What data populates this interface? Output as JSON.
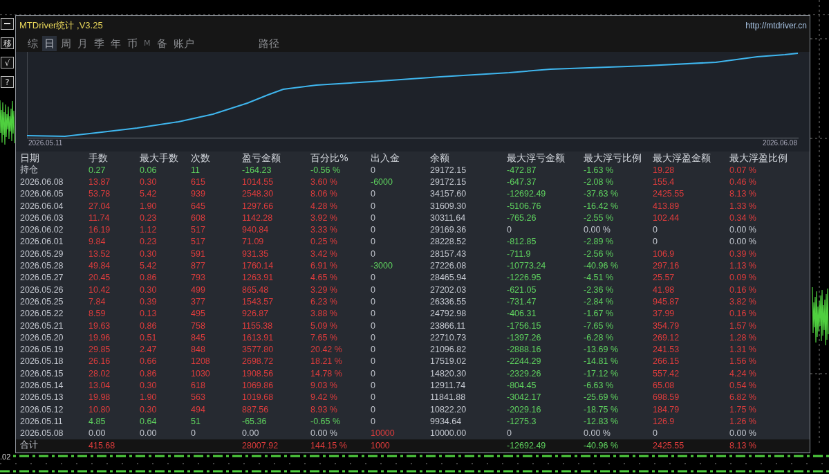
{
  "window": {
    "title": "MTDriver统计 ,V3.25",
    "link": "http://mtdriver.cn"
  },
  "side_buttons": [
    {
      "kind": "minimize"
    },
    {
      "kind": "text",
      "text": "移"
    },
    {
      "kind": "text",
      "text": "√"
    },
    {
      "kind": "text",
      "text": "?"
    }
  ],
  "tabs": [
    {
      "label": "综",
      "selected": false,
      "dim": false
    },
    {
      "label": "日",
      "selected": true,
      "dim": false
    },
    {
      "label": "周",
      "selected": false,
      "dim": false
    },
    {
      "label": "月",
      "selected": false,
      "dim": false
    },
    {
      "label": "季",
      "selected": false,
      "dim": false
    },
    {
      "label": "年",
      "selected": false,
      "dim": false
    },
    {
      "label": "币",
      "selected": false,
      "dim": false
    },
    {
      "label": "M",
      "selected": false,
      "dim": true
    },
    {
      "label": "备",
      "selected": false,
      "dim": false
    },
    {
      "label": "账户",
      "selected": false,
      "dim": false
    }
  ],
  "path_tab": {
    "label": "路径",
    "selected": false
  },
  "equity_chart": {
    "start_label": "2026.05.11",
    "end_label": "2026.06.08"
  },
  "table": {
    "columns": [
      "日期",
      "手数",
      "最大手数",
      "次数",
      "盈亏金额",
      "百分比%",
      "出入金",
      "余额",
      "最大浮亏金额",
      "最大浮亏比例",
      "最大浮盈金额",
      "最大浮盈比例"
    ],
    "rows": [
      {
        "date": "持仓",
        "lots": {
          "text": "0.27",
          "color": "#5fd35f"
        },
        "max_lots": {
          "text": "0.06",
          "color": "#5fd35f"
        },
        "trades": {
          "text": "11",
          "color": "#5fd35f"
        },
        "profit": {
          "text": "-164.23",
          "color": "#5fd35f"
        },
        "percent": {
          "text": "-0.56 %",
          "color": "#5fd35f"
        },
        "deposit": {
          "text": "0",
          "color": "#c4c8d0"
        },
        "balance": {
          "text": "29172.15",
          "color": "#c4c8d0"
        },
        "max_float_loss": {
          "text": "-472.87",
          "color": "#5fd35f"
        },
        "max_float_loss_pct": {
          "text": "-1.63 %",
          "color": "#5fd35f"
        },
        "max_float_profit": {
          "text": "19.28",
          "color": "#e03c3c"
        },
        "max_float_profit_pct": {
          "text": "0.07 %",
          "color": "#e03c3c"
        }
      },
      {
        "date": "2026.06.08",
        "lots": {
          "text": "13.87",
          "color": "#e03c3c"
        },
        "max_lots": {
          "text": "0.30",
          "color": "#e03c3c"
        },
        "trades": {
          "text": "615",
          "color": "#e03c3c"
        },
        "profit": {
          "text": "1014.55",
          "color": "#e03c3c"
        },
        "percent": {
          "text": "3.60 %",
          "color": "#e03c3c"
        },
        "deposit": {
          "text": "-6000",
          "color": "#5fd35f"
        },
        "balance": {
          "text": "29172.15",
          "color": "#c4c8d0"
        },
        "max_float_loss": {
          "text": "-647.37",
          "color": "#5fd35f"
        },
        "max_float_loss_pct": {
          "text": "-2.08 %",
          "color": "#5fd35f"
        },
        "max_float_profit": {
          "text": "155.4",
          "color": "#e03c3c"
        },
        "max_float_profit_pct": {
          "text": "0.46 %",
          "color": "#e03c3c"
        }
      },
      {
        "date": "2026.06.05",
        "lots": {
          "text": "53.78",
          "color": "#e03c3c"
        },
        "max_lots": {
          "text": "5.42",
          "color": "#e03c3c"
        },
        "trades": {
          "text": "939",
          "color": "#e03c3c"
        },
        "profit": {
          "text": "2548.30",
          "color": "#e03c3c"
        },
        "percent": {
          "text": "8.06 %",
          "color": "#e03c3c"
        },
        "deposit": {
          "text": "0",
          "color": "#c4c8d0"
        },
        "balance": {
          "text": "34157.60",
          "color": "#c4c8d0"
        },
        "max_float_loss": {
          "text": "-12692.49",
          "color": "#5fd35f"
        },
        "max_float_loss_pct": {
          "text": "-37.63 %",
          "color": "#5fd35f"
        },
        "max_float_profit": {
          "text": "2425.55",
          "color": "#e03c3c"
        },
        "max_float_profit_pct": {
          "text": "8.13 %",
          "color": "#e03c3c"
        }
      },
      {
        "date": "2026.06.04",
        "lots": {
          "text": "27.04",
          "color": "#e03c3c"
        },
        "max_lots": {
          "text": "1.90",
          "color": "#e03c3c"
        },
        "trades": {
          "text": "645",
          "color": "#e03c3c"
        },
        "profit": {
          "text": "1297.66",
          "color": "#e03c3c"
        },
        "percent": {
          "text": "4.28 %",
          "color": "#e03c3c"
        },
        "deposit": {
          "text": "0",
          "color": "#c4c8d0"
        },
        "balance": {
          "text": "31609.30",
          "color": "#c4c8d0"
        },
        "max_float_loss": {
          "text": "-5106.76",
          "color": "#5fd35f"
        },
        "max_float_loss_pct": {
          "text": "-16.42 %",
          "color": "#5fd35f"
        },
        "max_float_profit": {
          "text": "413.89",
          "color": "#e03c3c"
        },
        "max_float_profit_pct": {
          "text": "1.33 %",
          "color": "#e03c3c"
        }
      },
      {
        "date": "2026.06.03",
        "lots": {
          "text": "11.74",
          "color": "#e03c3c"
        },
        "max_lots": {
          "text": "0.23",
          "color": "#e03c3c"
        },
        "trades": {
          "text": "608",
          "color": "#e03c3c"
        },
        "profit": {
          "text": "1142.28",
          "color": "#e03c3c"
        },
        "percent": {
          "text": "3.92 %",
          "color": "#e03c3c"
        },
        "deposit": {
          "text": "0",
          "color": "#c4c8d0"
        },
        "balance": {
          "text": "30311.64",
          "color": "#c4c8d0"
        },
        "max_float_loss": {
          "text": "-765.26",
          "color": "#5fd35f"
        },
        "max_float_loss_pct": {
          "text": "-2.55 %",
          "color": "#5fd35f"
        },
        "max_float_profit": {
          "text": "102.44",
          "color": "#e03c3c"
        },
        "max_float_profit_pct": {
          "text": "0.34 %",
          "color": "#e03c3c"
        }
      },
      {
        "date": "2026.06.02",
        "lots": {
          "text": "16.19",
          "color": "#e03c3c"
        },
        "max_lots": {
          "text": "1.12",
          "color": "#e03c3c"
        },
        "trades": {
          "text": "517",
          "color": "#e03c3c"
        },
        "profit": {
          "text": "940.84",
          "color": "#e03c3c"
        },
        "percent": {
          "text": "3.33 %",
          "color": "#e03c3c"
        },
        "deposit": {
          "text": "0",
          "color": "#c4c8d0"
        },
        "balance": {
          "text": "29169.36",
          "color": "#c4c8d0"
        },
        "max_float_loss": {
          "text": "0",
          "color": "#c4c8d0"
        },
        "max_float_loss_pct": {
          "text": "0.00 %",
          "color": "#c4c8d0"
        },
        "max_float_profit": {
          "text": "0",
          "color": "#c4c8d0"
        },
        "max_float_profit_pct": {
          "text": "0.00 %",
          "color": "#c4c8d0"
        }
      },
      {
        "date": "2026.06.01",
        "lots": {
          "text": "9.84",
          "color": "#e03c3c"
        },
        "max_lots": {
          "text": "0.23",
          "color": "#e03c3c"
        },
        "trades": {
          "text": "517",
          "color": "#e03c3c"
        },
        "profit": {
          "text": "71.09",
          "color": "#e03c3c"
        },
        "percent": {
          "text": "0.25 %",
          "color": "#e03c3c"
        },
        "deposit": {
          "text": "0",
          "color": "#c4c8d0"
        },
        "balance": {
          "text": "28228.52",
          "color": "#c4c8d0"
        },
        "max_float_loss": {
          "text": "-812.85",
          "color": "#5fd35f"
        },
        "max_float_loss_pct": {
          "text": "-2.89 %",
          "color": "#5fd35f"
        },
        "max_float_profit": {
          "text": "0",
          "color": "#c4c8d0"
        },
        "max_float_profit_pct": {
          "text": "0.00 %",
          "color": "#c4c8d0"
        }
      },
      {
        "date": "2026.05.29",
        "lots": {
          "text": "13.52",
          "color": "#e03c3c"
        },
        "max_lots": {
          "text": "0.30",
          "color": "#e03c3c"
        },
        "trades": {
          "text": "591",
          "color": "#e03c3c"
        },
        "profit": {
          "text": "931.35",
          "color": "#e03c3c"
        },
        "percent": {
          "text": "3.42 %",
          "color": "#e03c3c"
        },
        "deposit": {
          "text": "0",
          "color": "#c4c8d0"
        },
        "balance": {
          "text": "28157.43",
          "color": "#c4c8d0"
        },
        "max_float_loss": {
          "text": "-711.9",
          "color": "#5fd35f"
        },
        "max_float_loss_pct": {
          "text": "-2.56 %",
          "color": "#5fd35f"
        },
        "max_float_profit": {
          "text": "106.9",
          "color": "#e03c3c"
        },
        "max_float_profit_pct": {
          "text": "0.39 %",
          "color": "#e03c3c"
        }
      },
      {
        "date": "2026.05.28",
        "lots": {
          "text": "49.84",
          "color": "#e03c3c"
        },
        "max_lots": {
          "text": "5.42",
          "color": "#e03c3c"
        },
        "trades": {
          "text": "877",
          "color": "#e03c3c"
        },
        "profit": {
          "text": "1760.14",
          "color": "#e03c3c"
        },
        "percent": {
          "text": "6.91 %",
          "color": "#e03c3c"
        },
        "deposit": {
          "text": "-3000",
          "color": "#5fd35f"
        },
        "balance": {
          "text": "27226.08",
          "color": "#c4c8d0"
        },
        "max_float_loss": {
          "text": "-10773.24",
          "color": "#5fd35f"
        },
        "max_float_loss_pct": {
          "text": "-40.96 %",
          "color": "#5fd35f"
        },
        "max_float_profit": {
          "text": "297.16",
          "color": "#e03c3c"
        },
        "max_float_profit_pct": {
          "text": "1.13 %",
          "color": "#e03c3c"
        }
      },
      {
        "date": "2026.05.27",
        "lots": {
          "text": "20.45",
          "color": "#e03c3c"
        },
        "max_lots": {
          "text": "0.86",
          "color": "#e03c3c"
        },
        "trades": {
          "text": "793",
          "color": "#e03c3c"
        },
        "profit": {
          "text": "1263.91",
          "color": "#e03c3c"
        },
        "percent": {
          "text": "4.65 %",
          "color": "#e03c3c"
        },
        "deposit": {
          "text": "0",
          "color": "#c4c8d0"
        },
        "balance": {
          "text": "28465.94",
          "color": "#c4c8d0"
        },
        "max_float_loss": {
          "text": "-1226.95",
          "color": "#5fd35f"
        },
        "max_float_loss_pct": {
          "text": "-4.51 %",
          "color": "#5fd35f"
        },
        "max_float_profit": {
          "text": "25.57",
          "color": "#e03c3c"
        },
        "max_float_profit_pct": {
          "text": "0.09 %",
          "color": "#e03c3c"
        }
      },
      {
        "date": "2026.05.26",
        "lots": {
          "text": "10.42",
          "color": "#e03c3c"
        },
        "max_lots": {
          "text": "0.30",
          "color": "#e03c3c"
        },
        "trades": {
          "text": "499",
          "color": "#e03c3c"
        },
        "profit": {
          "text": "865.48",
          "color": "#e03c3c"
        },
        "percent": {
          "text": "3.29 %",
          "color": "#e03c3c"
        },
        "deposit": {
          "text": "0",
          "color": "#c4c8d0"
        },
        "balance": {
          "text": "27202.03",
          "color": "#c4c8d0"
        },
        "max_float_loss": {
          "text": "-621.05",
          "color": "#5fd35f"
        },
        "max_float_loss_pct": {
          "text": "-2.36 %",
          "color": "#5fd35f"
        },
        "max_float_profit": {
          "text": "41.98",
          "color": "#e03c3c"
        },
        "max_float_profit_pct": {
          "text": "0.16 %",
          "color": "#e03c3c"
        }
      },
      {
        "date": "2026.05.25",
        "lots": {
          "text": "7.84",
          "color": "#e03c3c"
        },
        "max_lots": {
          "text": "0.39",
          "color": "#e03c3c"
        },
        "trades": {
          "text": "377",
          "color": "#e03c3c"
        },
        "profit": {
          "text": "1543.57",
          "color": "#e03c3c"
        },
        "percent": {
          "text": "6.23 %",
          "color": "#e03c3c"
        },
        "deposit": {
          "text": "0",
          "color": "#c4c8d0"
        },
        "balance": {
          "text": "26336.55",
          "color": "#c4c8d0"
        },
        "max_float_loss": {
          "text": "-731.47",
          "color": "#5fd35f"
        },
        "max_float_loss_pct": {
          "text": "-2.84 %",
          "color": "#5fd35f"
        },
        "max_float_profit": {
          "text": "945.87",
          "color": "#e03c3c"
        },
        "max_float_profit_pct": {
          "text": "3.82 %",
          "color": "#e03c3c"
        }
      },
      {
        "date": "2026.05.22",
        "lots": {
          "text": "8.59",
          "color": "#e03c3c"
        },
        "max_lots": {
          "text": "0.13",
          "color": "#e03c3c"
        },
        "trades": {
          "text": "495",
          "color": "#e03c3c"
        },
        "profit": {
          "text": "926.87",
          "color": "#e03c3c"
        },
        "percent": {
          "text": "3.88 %",
          "color": "#e03c3c"
        },
        "deposit": {
          "text": "0",
          "color": "#c4c8d0"
        },
        "balance": {
          "text": "24792.98",
          "color": "#c4c8d0"
        },
        "max_float_loss": {
          "text": "-406.31",
          "color": "#5fd35f"
        },
        "max_float_loss_pct": {
          "text": "-1.67 %",
          "color": "#5fd35f"
        },
        "max_float_profit": {
          "text": "37.99",
          "color": "#e03c3c"
        },
        "max_float_profit_pct": {
          "text": "0.16 %",
          "color": "#e03c3c"
        }
      },
      {
        "date": "2026.05.21",
        "lots": {
          "text": "19.63",
          "color": "#e03c3c"
        },
        "max_lots": {
          "text": "0.86",
          "color": "#e03c3c"
        },
        "trades": {
          "text": "758",
          "color": "#e03c3c"
        },
        "profit": {
          "text": "1155.38",
          "color": "#e03c3c"
        },
        "percent": {
          "text": "5.09 %",
          "color": "#e03c3c"
        },
        "deposit": {
          "text": "0",
          "color": "#c4c8d0"
        },
        "balance": {
          "text": "23866.11",
          "color": "#c4c8d0"
        },
        "max_float_loss": {
          "text": "-1756.15",
          "color": "#5fd35f"
        },
        "max_float_loss_pct": {
          "text": "-7.65 %",
          "color": "#5fd35f"
        },
        "max_float_profit": {
          "text": "354.79",
          "color": "#e03c3c"
        },
        "max_float_profit_pct": {
          "text": "1.57 %",
          "color": "#e03c3c"
        }
      },
      {
        "date": "2026.05.20",
        "lots": {
          "text": "19.96",
          "color": "#e03c3c"
        },
        "max_lots": {
          "text": "0.51",
          "color": "#e03c3c"
        },
        "trades": {
          "text": "845",
          "color": "#e03c3c"
        },
        "profit": {
          "text": "1613.91",
          "color": "#e03c3c"
        },
        "percent": {
          "text": "7.65 %",
          "color": "#e03c3c"
        },
        "deposit": {
          "text": "0",
          "color": "#c4c8d0"
        },
        "balance": {
          "text": "22710.73",
          "color": "#c4c8d0"
        },
        "max_float_loss": {
          "text": "-1397.26",
          "color": "#5fd35f"
        },
        "max_float_loss_pct": {
          "text": "-6.28 %",
          "color": "#5fd35f"
        },
        "max_float_profit": {
          "text": "269.12",
          "color": "#e03c3c"
        },
        "max_float_profit_pct": {
          "text": "1.28 %",
          "color": "#e03c3c"
        }
      },
      {
        "date": "2026.05.19",
        "lots": {
          "text": "29.85",
          "color": "#e03c3c"
        },
        "max_lots": {
          "text": "2.47",
          "color": "#e03c3c"
        },
        "trades": {
          "text": "848",
          "color": "#e03c3c"
        },
        "profit": {
          "text": "3577.80",
          "color": "#e03c3c"
        },
        "percent": {
          "text": "20.42 %",
          "color": "#e03c3c"
        },
        "deposit": {
          "text": "0",
          "color": "#c4c8d0"
        },
        "balance": {
          "text": "21096.82",
          "color": "#c4c8d0"
        },
        "max_float_loss": {
          "text": "-2888.16",
          "color": "#5fd35f"
        },
        "max_float_loss_pct": {
          "text": "-13.69 %",
          "color": "#5fd35f"
        },
        "max_float_profit": {
          "text": "241.53",
          "color": "#e03c3c"
        },
        "max_float_profit_pct": {
          "text": "1.31 %",
          "color": "#e03c3c"
        }
      },
      {
        "date": "2026.05.18",
        "lots": {
          "text": "26.16",
          "color": "#e03c3c"
        },
        "max_lots": {
          "text": "0.66",
          "color": "#e03c3c"
        },
        "trades": {
          "text": "1208",
          "color": "#e03c3c"
        },
        "profit": {
          "text": "2698.72",
          "color": "#e03c3c"
        },
        "percent": {
          "text": "18.21 %",
          "color": "#e03c3c"
        },
        "deposit": {
          "text": "0",
          "color": "#c4c8d0"
        },
        "balance": {
          "text": "17519.02",
          "color": "#c4c8d0"
        },
        "max_float_loss": {
          "text": "-2244.29",
          "color": "#5fd35f"
        },
        "max_float_loss_pct": {
          "text": "-14.81 %",
          "color": "#5fd35f"
        },
        "max_float_profit": {
          "text": "266.15",
          "color": "#e03c3c"
        },
        "max_float_profit_pct": {
          "text": "1.56 %",
          "color": "#e03c3c"
        }
      },
      {
        "date": "2026.05.15",
        "lots": {
          "text": "28.02",
          "color": "#e03c3c"
        },
        "max_lots": {
          "text": "0.86",
          "color": "#e03c3c"
        },
        "trades": {
          "text": "1030",
          "color": "#e03c3c"
        },
        "profit": {
          "text": "1908.56",
          "color": "#e03c3c"
        },
        "percent": {
          "text": "14.78 %",
          "color": "#e03c3c"
        },
        "deposit": {
          "text": "0",
          "color": "#c4c8d0"
        },
        "balance": {
          "text": "14820.30",
          "color": "#c4c8d0"
        },
        "max_float_loss": {
          "text": "-2329.26",
          "color": "#5fd35f"
        },
        "max_float_loss_pct": {
          "text": "-17.12 %",
          "color": "#5fd35f"
        },
        "max_float_profit": {
          "text": "557.42",
          "color": "#e03c3c"
        },
        "max_float_profit_pct": {
          "text": "4.24 %",
          "color": "#e03c3c"
        }
      },
      {
        "date": "2026.05.14",
        "lots": {
          "text": "13.04",
          "color": "#e03c3c"
        },
        "max_lots": {
          "text": "0.30",
          "color": "#e03c3c"
        },
        "trades": {
          "text": "618",
          "color": "#e03c3c"
        },
        "profit": {
          "text": "1069.86",
          "color": "#e03c3c"
        },
        "percent": {
          "text": "9.03 %",
          "color": "#e03c3c"
        },
        "deposit": {
          "text": "0",
          "color": "#c4c8d0"
        },
        "balance": {
          "text": "12911.74",
          "color": "#c4c8d0"
        },
        "max_float_loss": {
          "text": "-804.45",
          "color": "#5fd35f"
        },
        "max_float_loss_pct": {
          "text": "-6.63 %",
          "color": "#5fd35f"
        },
        "max_float_profit": {
          "text": "65.08",
          "color": "#e03c3c"
        },
        "max_float_profit_pct": {
          "text": "0.54 %",
          "color": "#e03c3c"
        }
      },
      {
        "date": "2026.05.13",
        "lots": {
          "text": "19.98",
          "color": "#e03c3c"
        },
        "max_lots": {
          "text": "1.90",
          "color": "#e03c3c"
        },
        "trades": {
          "text": "563",
          "color": "#e03c3c"
        },
        "profit": {
          "text": "1019.68",
          "color": "#e03c3c"
        },
        "percent": {
          "text": "9.42 %",
          "color": "#e03c3c"
        },
        "deposit": {
          "text": "0",
          "color": "#c4c8d0"
        },
        "balance": {
          "text": "11841.88",
          "color": "#c4c8d0"
        },
        "max_float_loss": {
          "text": "-3042.17",
          "color": "#5fd35f"
        },
        "max_float_loss_pct": {
          "text": "-25.69 %",
          "color": "#5fd35f"
        },
        "max_float_profit": {
          "text": "698.59",
          "color": "#e03c3c"
        },
        "max_float_profit_pct": {
          "text": "6.82 %",
          "color": "#e03c3c"
        }
      },
      {
        "date": "2026.05.12",
        "lots": {
          "text": "10.80",
          "color": "#e03c3c"
        },
        "max_lots": {
          "text": "0.30",
          "color": "#e03c3c"
        },
        "trades": {
          "text": "494",
          "color": "#e03c3c"
        },
        "profit": {
          "text": "887.56",
          "color": "#e03c3c"
        },
        "percent": {
          "text": "8.93 %",
          "color": "#e03c3c"
        },
        "deposit": {
          "text": "0",
          "color": "#c4c8d0"
        },
        "balance": {
          "text": "10822.20",
          "color": "#c4c8d0"
        },
        "max_float_loss": {
          "text": "-2029.16",
          "color": "#5fd35f"
        },
        "max_float_loss_pct": {
          "text": "-18.75 %",
          "color": "#5fd35f"
        },
        "max_float_profit": {
          "text": "184.79",
          "color": "#e03c3c"
        },
        "max_float_profit_pct": {
          "text": "1.75 %",
          "color": "#e03c3c"
        }
      },
      {
        "date": "2026.05.11",
        "lots": {
          "text": "4.85",
          "color": "#5fd35f"
        },
        "max_lots": {
          "text": "0.64",
          "color": "#5fd35f"
        },
        "trades": {
          "text": "51",
          "color": "#5fd35f"
        },
        "profit": {
          "text": "-65.36",
          "color": "#5fd35f"
        },
        "percent": {
          "text": "-0.65 %",
          "color": "#5fd35f"
        },
        "deposit": {
          "text": "0",
          "color": "#c4c8d0"
        },
        "balance": {
          "text": "9934.64",
          "color": "#c4c8d0"
        },
        "max_float_loss": {
          "text": "-1275.3",
          "color": "#5fd35f"
        },
        "max_float_loss_pct": {
          "text": "-12.83 %",
          "color": "#5fd35f"
        },
        "max_float_profit": {
          "text": "126.9",
          "color": "#e03c3c"
        },
        "max_float_profit_pct": {
          "text": "1.26 %",
          "color": "#e03c3c"
        }
      },
      {
        "date": "2026.05.08",
        "lots": {
          "text": "0.00",
          "color": "#c4c8d0"
        },
        "max_lots": {
          "text": "0.00",
          "color": "#c4c8d0"
        },
        "trades": {
          "text": "0",
          "color": "#c4c8d0"
        },
        "profit": {
          "text": "0.00",
          "color": "#c4c8d0"
        },
        "percent": {
          "text": "0.00 %",
          "color": "#c4c8d0"
        },
        "deposit": {
          "text": "10000",
          "color": "#e03c3c"
        },
        "balance": {
          "text": "10000.00",
          "color": "#c4c8d0"
        },
        "max_float_loss": {
          "text": "0",
          "color": "#c4c8d0"
        },
        "max_float_loss_pct": {
          "text": "0.00 %",
          "color": "#c4c8d0"
        },
        "max_float_profit": {
          "text": "0",
          "color": "#c4c8d0"
        },
        "max_float_profit_pct": {
          "text": "0.00 %",
          "color": "#c4c8d0"
        }
      }
    ],
    "total": {
      "date": "合计",
      "lots": {
        "text": "415.68",
        "color": "#e03c3c"
      },
      "profit": {
        "text": "28007.92",
        "color": "#e03c3c"
      },
      "percent": {
        "text": "144.15 %",
        "color": "#e03c3c"
      },
      "deposit": {
        "text": "1000",
        "color": "#e03c3c"
      },
      "max_float_loss": {
        "text": "-12692.49",
        "color": "#5fd35f"
      },
      "max_float_loss_pct": {
        "text": "-40.96 %",
        "color": "#5fd35f"
      },
      "max_float_profit": {
        "text": "2425.55",
        "color": "#e03c3c"
      },
      "max_float_profit_pct": {
        "text": "8.13 %",
        "color": "#e03c3c"
      }
    }
  },
  "backdrop": {
    "price_label": ".02"
  }
}
